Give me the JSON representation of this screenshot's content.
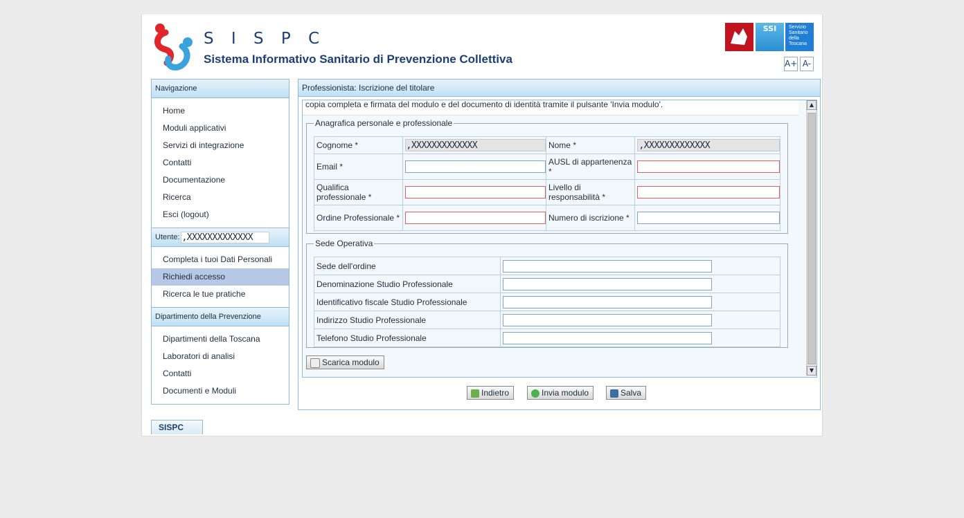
{
  "header": {
    "title": "S I S P C",
    "subtitle": "Sistema Informativo Sanitario di Prevenzione Collettiva",
    "ssi_text": "SSI",
    "sst_text": "Servizio Sanitario della Toscana",
    "font_increase": "A+",
    "font_decrease": "A-"
  },
  "sidebar": {
    "nav_title": "Navigazione",
    "nav_items": [
      "Home",
      "Moduli applicativi",
      "Servizi di integrazione",
      "Contatti",
      "Documentazione",
      "Ricerca",
      "Esci (logout)"
    ],
    "user_label": "Utente:",
    "user_value": ",XXXXXXXXXXXXX",
    "user_items": [
      "Completa i tuoi Dati Personali",
      "Richiedi accesso",
      "Ricerca le tue pratiche"
    ],
    "dept_title": "Dipartimento della Prevenzione",
    "dept_items": [
      "Dipartimenti della Toscana",
      "Laboratori di analisi",
      "Contatti",
      "Documenti e Moduli"
    ]
  },
  "panel": {
    "title": "Professionista: Iscrizione del titolare",
    "intro_text": "copia completa e firmata del modulo e del documento di identità tramite il pulsante 'Invia modulo'.",
    "anagrafica": {
      "legend": "Anagrafica personale e professionale",
      "cognome_label": "Cognome *",
      "cognome_value": ",XXXXXXXXXXXXX",
      "nome_label": "Nome *",
      "nome_value": ",XXXXXXXXXXXXX",
      "email_label": "Email *",
      "ausl_label": "AUSL di appartenenza *",
      "qualifica_label": "Qualifica professionale *",
      "livello_label": "Livello di responsabilità *",
      "ordine_label": "Ordine Professionale *",
      "numero_label": "Numero di iscrizione *"
    },
    "sede": {
      "legend": "Sede Operativa",
      "rows": [
        "Sede dell'ordine",
        "Denominazione Studio Professionale",
        "Identificativo fiscale Studio Professionale",
        "Indirizzo Studio Professionale",
        "Telefono Studio Professionale"
      ]
    },
    "scarica_label": "Scarica modulo",
    "indietro_label": "Indietro",
    "invia_label": "Invia modulo",
    "salva_label": "Salva"
  },
  "footer": {
    "tab_label": "SISPC"
  }
}
